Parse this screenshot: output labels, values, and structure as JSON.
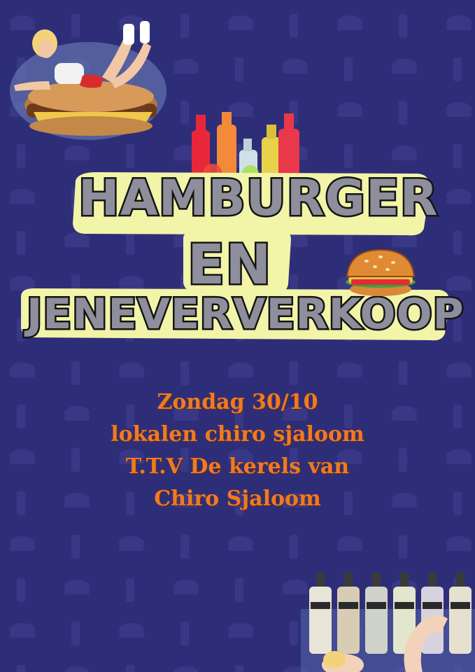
{
  "title": {
    "line1": "HAMBURGER",
    "line2": "EN",
    "line3": "JENEVERVERKOOP"
  },
  "info": {
    "lines": [
      "Zondag 30/10",
      "lokalen chiro sjaloom",
      "T.T.V De kerels van",
      "Chiro Sjaloom"
    ]
  },
  "colors": {
    "background": "#2e2e78",
    "title_fill": "#8e8e9c",
    "title_outline": "#141414",
    "title_glow": "#f2f4a8",
    "info_text": "#f07a22"
  },
  "images": {
    "top_left": "pinup-on-hamburger-illustration",
    "top_center": "jenever-bottles-illustration",
    "burger": "cartoon-hamburger-icon",
    "bottom_right": "jenever-bottles-with-pinup-illustration"
  }
}
